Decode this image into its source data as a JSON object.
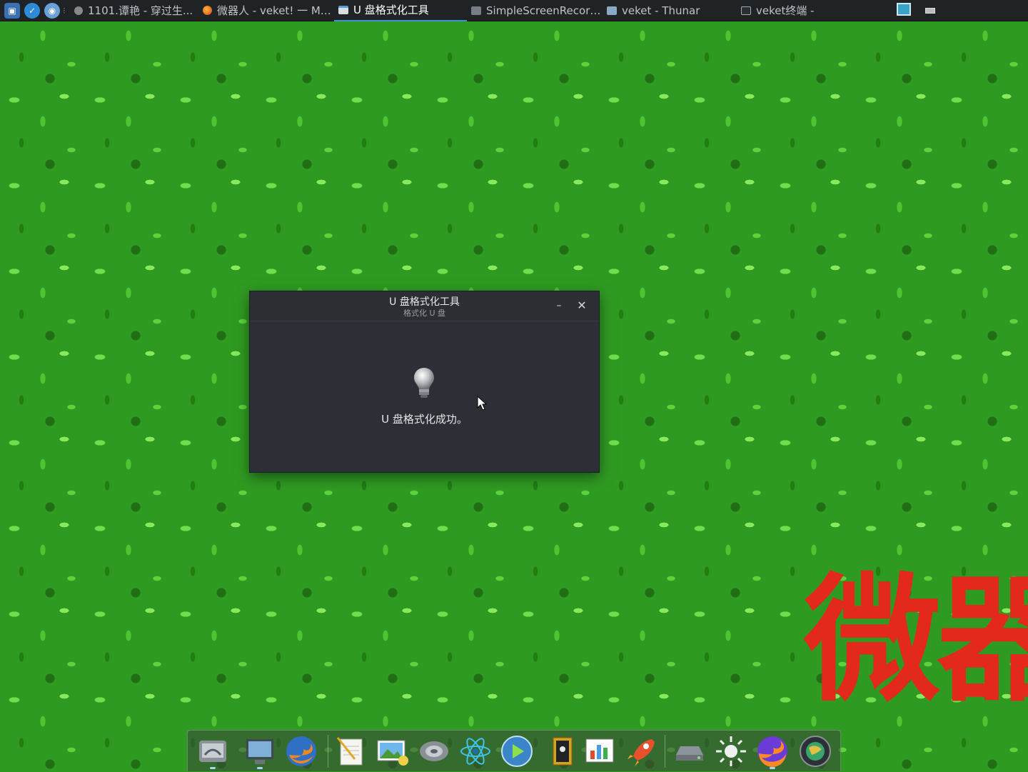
{
  "top_panel": {
    "launchers": [
      {
        "icon": "screenshot-app-icon"
      },
      {
        "icon": "browser-app-icon"
      },
      {
        "icon": "network-app-icon"
      }
    ],
    "tasks": [
      {
        "label": "1101.谭艳 - 穿过生...",
        "icon": "record-icon",
        "active": false
      },
      {
        "label": "微器人 - veket! 一 M…",
        "icon": "firefox-icon",
        "active": false
      },
      {
        "label": "U 盘格式化工具",
        "icon": "window-icon",
        "active": true
      },
      {
        "label": "SimpleScreenRecor…",
        "icon": "window-icon",
        "active": false
      },
      {
        "label": "veket - Thunar",
        "icon": "folder-icon",
        "active": false
      },
      {
        "label": "veket终端 -",
        "icon": "terminal-icon",
        "active": false
      }
    ],
    "tray": [
      {
        "icon": "display-monitor-icon"
      },
      {
        "icon": "battery-icon"
      }
    ]
  },
  "dialog": {
    "title": "U 盘格式化工具",
    "subtitle": "格式化 U 盘",
    "minimize_label": "–",
    "close_label": "✕",
    "icon": "lightbulb-icon",
    "message": "U 盘格式化成功。"
  },
  "watermark": {
    "text": "微器",
    "color": "#e3281c"
  },
  "dock": {
    "items": [
      {
        "icon": "disk-utility-icon"
      },
      {
        "icon": "monitor-icon"
      },
      {
        "icon": "firefox-browser-icon"
      },
      {
        "icon": "text-editor-icon"
      },
      {
        "icon": "image-viewer-icon"
      },
      {
        "icon": "speaker-icon"
      },
      {
        "icon": "atom-icon"
      },
      {
        "icon": "media-player-icon"
      },
      {
        "icon": "address-book-icon"
      },
      {
        "icon": "chart-icon"
      },
      {
        "icon": "rocket-icon"
      },
      {
        "icon": "drive-icon"
      },
      {
        "icon": "sun-settings-icon"
      },
      {
        "icon": "firefox-icon"
      },
      {
        "icon": "globe-icon"
      }
    ]
  }
}
